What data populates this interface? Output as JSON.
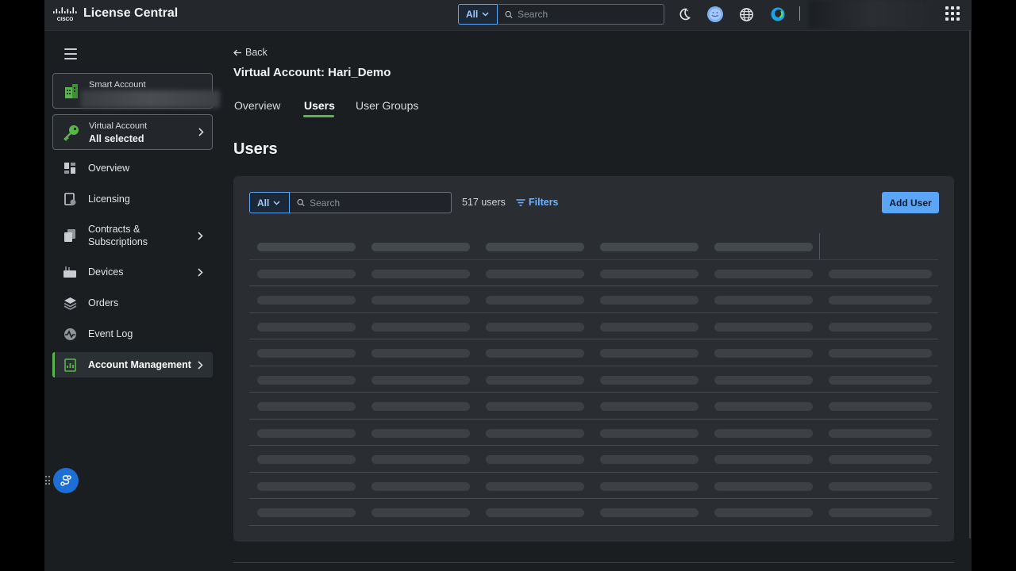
{
  "app": {
    "brand": "License Central"
  },
  "topbar": {
    "scope_label": "All",
    "search_placeholder": "Search"
  },
  "sidebar": {
    "smart_account": {
      "label": "Smart Account",
      "value": ""
    },
    "virtual_account": {
      "label": "Virtual Account",
      "value": "All selected"
    },
    "items": [
      {
        "label": "Overview",
        "has_chevron": false,
        "active": false
      },
      {
        "label": "Licensing",
        "has_chevron": false,
        "active": false
      },
      {
        "label": "Contracts &",
        "label2": "Subscriptions",
        "has_chevron": true,
        "active": false
      },
      {
        "label": "Devices",
        "has_chevron": true,
        "active": false
      },
      {
        "label": "Orders",
        "has_chevron": false,
        "active": false
      },
      {
        "label": "Event Log",
        "has_chevron": false,
        "active": false
      },
      {
        "label": "Account Management",
        "has_chevron": true,
        "active": true
      }
    ]
  },
  "main": {
    "back_label": "Back",
    "heading": "Virtual Account: Hari_Demo",
    "tabs": [
      {
        "label": "Overview",
        "active": false
      },
      {
        "label": "Users",
        "active": true
      },
      {
        "label": "User Groups",
        "active": false
      }
    ],
    "section_title": "Users",
    "toolbar": {
      "scope_label": "All",
      "search_placeholder": "Search",
      "count": "517 users",
      "filters_label": "Filters",
      "add_user_label": "Add User"
    },
    "table": {
      "state": "loading",
      "skeleton_rows": 10,
      "skeleton_columns": 6
    }
  },
  "colors": {
    "accent_green": "#5ab54b",
    "accent_blue": "#5aa5f6",
    "background": "#1b1e21"
  }
}
